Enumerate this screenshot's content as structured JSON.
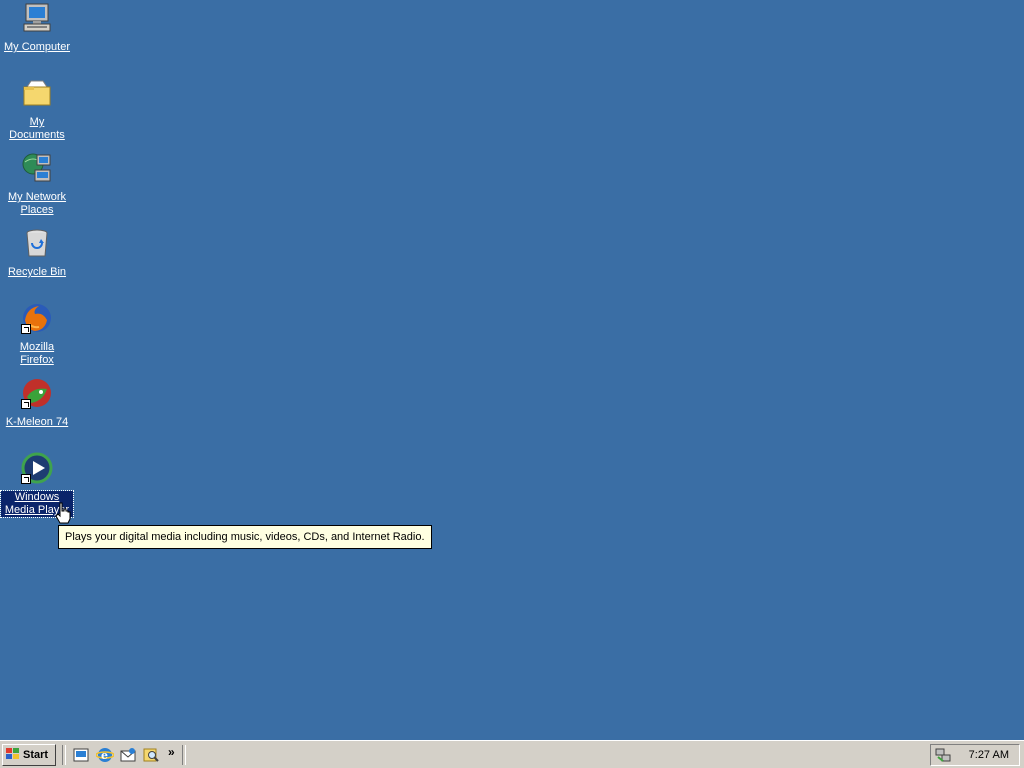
{
  "desktop": {
    "background_color": "#3a6ea5",
    "icons": [
      {
        "label": "My Computer",
        "icon": "my-computer-icon"
      },
      {
        "label": "My Documents",
        "icon": "folder-icon"
      },
      {
        "label": "My Network Places",
        "icon": "network-places-icon"
      },
      {
        "label": "Recycle Bin",
        "icon": "recycle-bin-icon"
      },
      {
        "label": "Mozilla Firefox",
        "icon": "firefox-icon"
      },
      {
        "label": "K-Meleon 74",
        "icon": "k-meleon-icon"
      },
      {
        "label": "Windows Media Player",
        "icon": "media-player-icon",
        "selected": true
      }
    ]
  },
  "tooltip": {
    "text": "Plays your digital media including music, videos, CDs, and Internet Radio."
  },
  "taskbar": {
    "start_label": "Start",
    "quick_launch": [
      "show-desktop-icon",
      "internet-explorer-icon",
      "outlook-express-icon",
      "search-icon"
    ],
    "more_label": "»",
    "clock": "7:27 AM"
  }
}
